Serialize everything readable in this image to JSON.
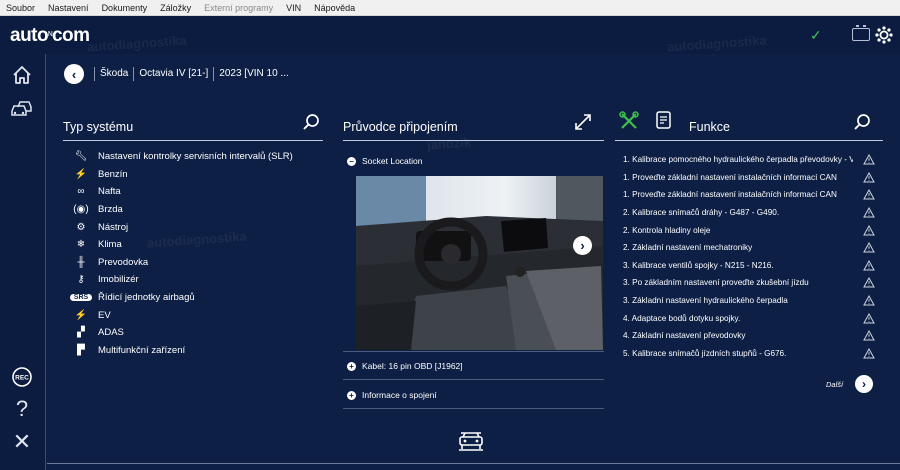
{
  "menu": [
    "Soubor",
    "Nastavení",
    "Dokumenty",
    "Záložky",
    "Externí programy",
    "VIN",
    "Nápověda"
  ],
  "header": {
    "logo": "auto",
    "logo_mark": "ᴺ",
    "logo_tail": "com"
  },
  "breadcrumb": [
    "Škoda",
    "Octavia IV [21-]",
    "2023 [VIN 10 ..."
  ],
  "systems": {
    "title": "Typ systému",
    "items": [
      {
        "icon": "wrench-icon",
        "label": "Nastavení kontrolky servisních intervalů (SLR)"
      },
      {
        "icon": "fuel-injection-icon",
        "label": "Benzín"
      },
      {
        "icon": "diesel-icon",
        "label": "Nafta"
      },
      {
        "icon": "brake-icon",
        "label": "Brzda"
      },
      {
        "icon": "tools-icon",
        "label": "Nástroj"
      },
      {
        "icon": "climate-icon",
        "label": "Klima"
      },
      {
        "icon": "gearbox-icon",
        "label": "Prevodovka"
      },
      {
        "icon": "immobilizer-icon",
        "label": "Imobilizér"
      },
      {
        "icon": "airbag-icon",
        "label": "Řídicí jednotky airbagů"
      },
      {
        "icon": "ev-icon",
        "label": "EV"
      },
      {
        "icon": "adas-icon",
        "label": "ADAS"
      },
      {
        "icon": "multifunction-icon",
        "label": "Multifunkční zařízení"
      }
    ]
  },
  "guide": {
    "title": "Průvodce připojením",
    "socket_location": "Socket Location",
    "cable": "Kabel: 16 pin OBD [J1962]",
    "connection_info": "Informace o spojení"
  },
  "functions": {
    "title": "Funkce",
    "items": [
      "1. Kalibrace pomocného hydraulického čerpadla převodovky - V...",
      "1. Proveďte základní nastavení instalačních informací CAN",
      "1. Proveďte základní nastavení instalačních informací CAN",
      "2. Kalibrace snímačů dráhy - G487 - G490.",
      "2. Kontrola hladiny oleje",
      "2. Základní nastavení mechatroniky",
      "3. Kalibrace ventilů spojky - N215 - N216.",
      "3. Po základním nastavení proveďte zkušební jízdu",
      "3. Základní nastavení hydraulického čerpadla",
      "4. Adaptace bodů dotyku spojky.",
      "4. Základní nastavení převodovky",
      "5. Kalibrace snímačů jízdních stupňů - G676."
    ],
    "next_label": "Další"
  },
  "watermarks": [
    "autodiagnostika",
    "janozik"
  ],
  "colors": {
    "background": "#0d1f45",
    "accent_green": "#3fc04a",
    "title_bar": "#f0f0f0"
  }
}
